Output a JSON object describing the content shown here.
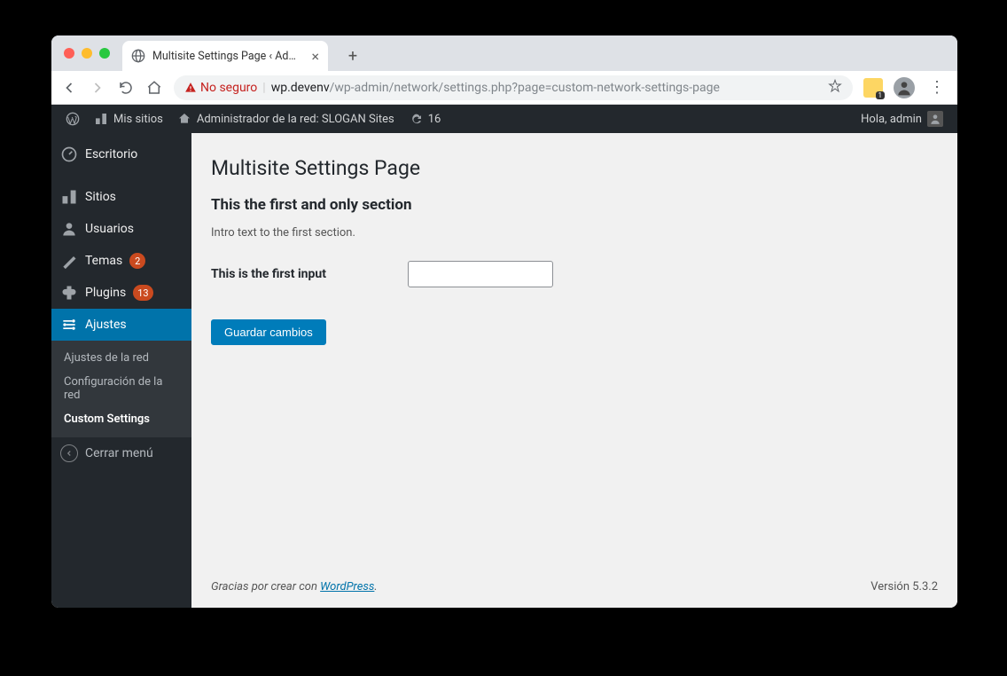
{
  "browser": {
    "tab_title": "Multisite Settings Page ‹ Adminis…",
    "not_secure_label": "No seguro",
    "url_host": "wp.devenv",
    "url_path": "/wp-admin/network/settings.php?page=custom-network-settings-page"
  },
  "adminbar": {
    "my_sites": "Mis sitios",
    "network_admin": "Administrador de la red: SLOGAN Sites",
    "updates_count": "16",
    "greeting": "Hola, admin"
  },
  "sidebar": {
    "items": [
      {
        "label": "Escritorio"
      },
      {
        "label": "Sitios"
      },
      {
        "label": "Usuarios"
      },
      {
        "label": "Temas",
        "badge": "2"
      },
      {
        "label": "Plugins",
        "badge": "13"
      },
      {
        "label": "Ajustes"
      }
    ],
    "submenu": [
      {
        "label": "Ajustes de la red"
      },
      {
        "label": "Configuración de la red"
      },
      {
        "label": "Custom Settings"
      }
    ],
    "collapse": "Cerrar menú"
  },
  "page": {
    "title": "Multisite Settings Page",
    "section_title": "This the first and only section",
    "section_intro": "Intro text to the first section.",
    "input_label": "This is the first input",
    "input_value": "",
    "submit_label": "Guardar cambios"
  },
  "footer": {
    "thanks_prefix": "Gracias por crear con ",
    "wp_link": "WordPress",
    "thanks_suffix": ".",
    "version": "Versión 5.3.2"
  }
}
